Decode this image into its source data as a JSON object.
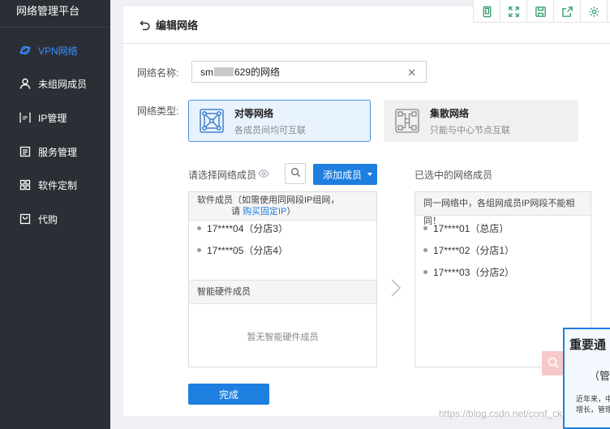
{
  "app": {
    "title": "网络管理平台"
  },
  "sidebar": {
    "items": [
      {
        "label": "VPN网络",
        "icon": "planet-icon",
        "active": true
      },
      {
        "label": "未组网成员",
        "icon": "user-icon",
        "active": false
      },
      {
        "label": "IP管理",
        "icon": "ip-icon",
        "active": false
      },
      {
        "label": "服务管理",
        "icon": "list-icon",
        "active": false
      },
      {
        "label": "软件定制",
        "icon": "grid-icon",
        "active": false
      },
      {
        "label": "代购",
        "icon": "bag-icon",
        "active": false
      }
    ]
  },
  "page": {
    "title": "编辑网络"
  },
  "form": {
    "name_label": "网络名称:",
    "name_value_prefix": "sm",
    "name_value_suffix": "629的网络",
    "type_label": "网络类型:",
    "types": [
      {
        "title": "对等网络",
        "desc": "各成员间均可互联",
        "selected": true
      },
      {
        "title": "集散网络",
        "desc": "只能与中心节点互联",
        "selected": false
      }
    ]
  },
  "members": {
    "select_label": "请选择网络成员",
    "add_button": "添加成员",
    "software_head_line1": "软件成员（如需使用同网段IP组网，",
    "software_head_line2_prefix": "请 ",
    "software_head_link": "购买固定IP",
    "software_head_line2_suffix": "）",
    "software_items": [
      "17****04（分店3）",
      "17****05（分店4）"
    ],
    "hardware_head": "智能硬件成员",
    "hardware_empty": "暂无智能硬件成员",
    "selected_label": "已选中的网络成员",
    "selected_head": "同一网络中，各组网成员IP网段不能相同！",
    "selected_items": [
      "17****01（总店）",
      "17****02（分店1）",
      "17****03（分店2）"
    ]
  },
  "actions": {
    "done": "完成"
  },
  "notice": {
    "title": "重要通",
    "subtitle": "（管理",
    "text_line1": "近年来，中",
    "text_line2": "增长，管理"
  },
  "watermark": "https://blog.csdn.net/conf_ck",
  "colors": {
    "primary": "#1e7fe0",
    "sidebar_bg": "#2b2f35",
    "active_nav": "#3b8cff"
  }
}
